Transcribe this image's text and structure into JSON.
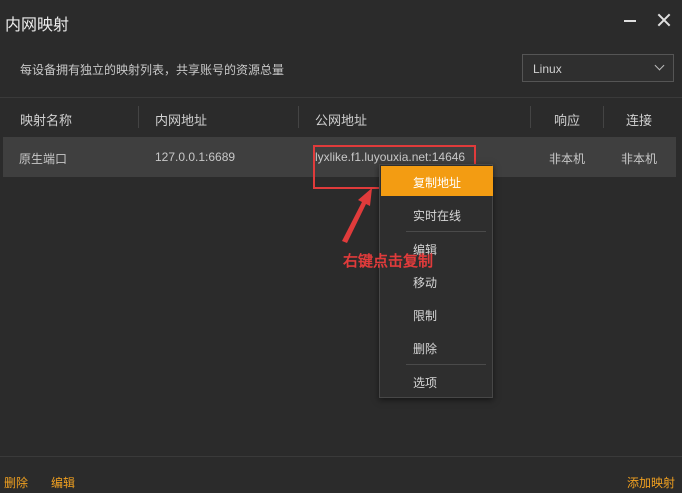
{
  "window": {
    "title": "内网映射"
  },
  "description": "每设备拥有独立的映射列表，共享账号的资源总量",
  "os_select": {
    "value": "Linux"
  },
  "table": {
    "headers": [
      "映射名称",
      "内网地址",
      "公网地址",
      "响应",
      "连接"
    ],
    "rows": [
      {
        "name": "原生端口",
        "local": "127.0.0.1:6689",
        "public": "lyxlike.f1.luyouxia.net:14646",
        "response": "非本机",
        "connect": "非本机"
      }
    ]
  },
  "context_menu": {
    "items": [
      "复制地址",
      "实时在线",
      "编辑",
      "移动",
      "限制",
      "删除",
      "选项"
    ]
  },
  "annotation": {
    "text": "右键点击复制",
    "color": "#e03b3b"
  },
  "footer": {
    "delete": "删除",
    "edit": "编辑",
    "add": "添加映射"
  },
  "colors": {
    "accent": "#f39c12",
    "background": "#2b2b2b",
    "row_selected": "#3f3f3f"
  }
}
